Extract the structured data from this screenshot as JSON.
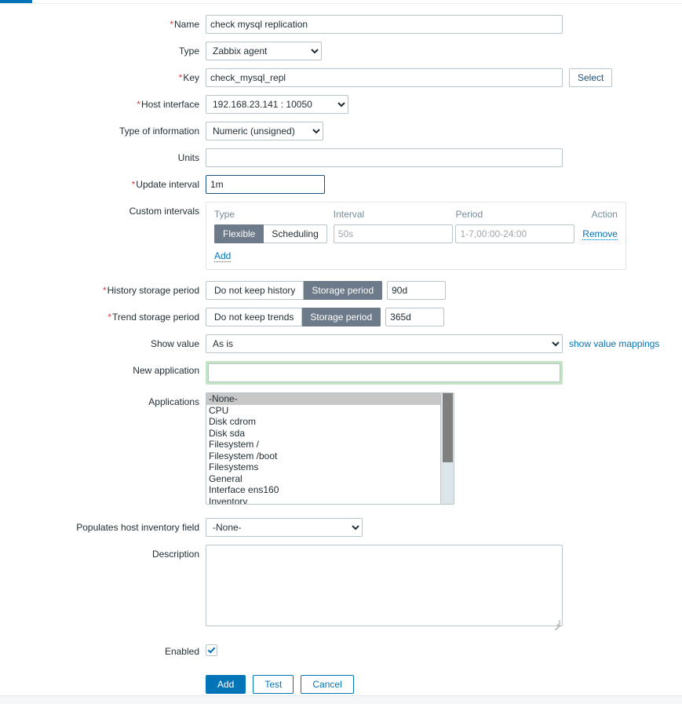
{
  "form": {
    "name": {
      "label": "Name",
      "required": true,
      "value": "check mysql replication"
    },
    "type": {
      "label": "Type",
      "required": false,
      "value": "Zabbix agent",
      "options": [
        "Zabbix agent"
      ]
    },
    "key": {
      "label": "Key",
      "required": true,
      "value": "check_mysql_repl",
      "select_button": "Select"
    },
    "host_interface": {
      "label": "Host interface",
      "required": true,
      "value": "192.168.23.141 : 10050",
      "options": [
        "192.168.23.141 : 10050"
      ]
    },
    "type_of_information": {
      "label": "Type of information",
      "required": false,
      "value": "Numeric (unsigned)",
      "options": [
        "Numeric (unsigned)"
      ]
    },
    "units": {
      "label": "Units",
      "required": false,
      "value": ""
    },
    "update_interval": {
      "label": "Update interval",
      "required": true,
      "value": "1m",
      "focused": true
    },
    "custom_intervals": {
      "label": "Custom intervals",
      "columns": {
        "type": "Type",
        "interval": "Interval",
        "period": "Period",
        "action": "Action"
      },
      "rows": [
        {
          "type_options": [
            "Flexible",
            "Scheduling"
          ],
          "type_selected": "Flexible",
          "interval_value": "",
          "interval_placeholder": "50s",
          "period_value": "",
          "period_placeholder": "1-7,00:00-24:00",
          "action_label": "Remove"
        }
      ],
      "add_label": "Add"
    },
    "history_storage_period": {
      "label": "History storage period",
      "required": true,
      "options": [
        "Do not keep history",
        "Storage period"
      ],
      "selected": "Storage period",
      "value": "90d"
    },
    "trend_storage_period": {
      "label": "Trend storage period",
      "required": true,
      "options": [
        "Do not keep trends",
        "Storage period"
      ],
      "selected": "Storage period",
      "value": "365d"
    },
    "show_value": {
      "label": "Show value",
      "required": false,
      "value": "As is",
      "options": [
        "As is"
      ],
      "link_label": "show value mappings"
    },
    "new_application": {
      "label": "New application",
      "required": false,
      "value": "",
      "highlight_color": "#c5e3c5"
    },
    "applications": {
      "label": "Applications",
      "selected": "-None-",
      "items": [
        "-None-",
        "CPU",
        "Disk cdrom",
        "Disk sda",
        "Filesystem /",
        "Filesystem /boot",
        "Filesystems",
        "General",
        "Interface ens160",
        "Inventory"
      ]
    },
    "host_inventory_field": {
      "label": "Populates host inventory field",
      "required": false,
      "value": "-None-",
      "options": [
        "-None-"
      ]
    },
    "description": {
      "label": "Description",
      "required": false,
      "value": ""
    },
    "enabled": {
      "label": "Enabled",
      "checked": true
    }
  },
  "buttons": {
    "add": "Add",
    "test": "Test",
    "cancel": "Cancel"
  },
  "colors": {
    "accent": "#0275b8",
    "required": "#d23b3b",
    "toggle_selected": "#6c7a89",
    "highlight_green": "#c5e3c5",
    "list_selected": "#c8c8c8"
  }
}
